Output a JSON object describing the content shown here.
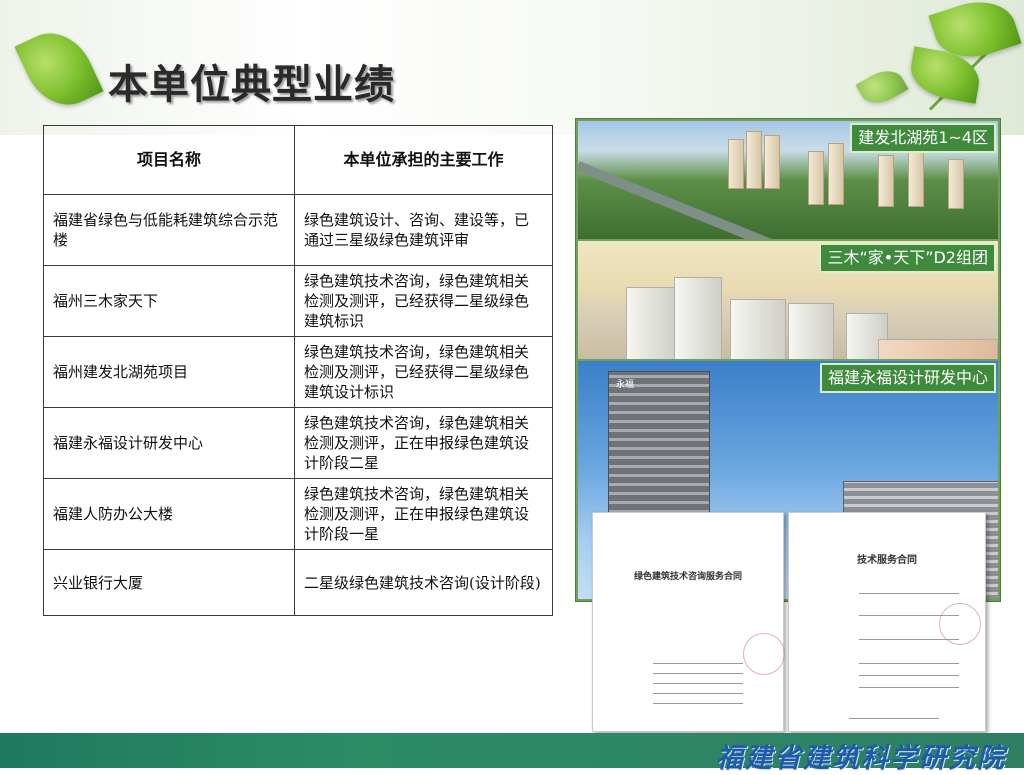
{
  "page_title": "本单位典型业绩",
  "table": {
    "headers": [
      "项目名称",
      "本单位承担的主要工作"
    ],
    "rows": [
      {
        "name": "福建省绿色与低能耗建筑综合示范楼",
        "work": "绿色建筑设计、咨询、建设等，已通过三星级绿色建筑评审"
      },
      {
        "name": "福州三木家天下",
        "work": "绿色建筑技术咨询，绿色建筑相关检测及测评，已经获得二星级绿色建筑标识"
      },
      {
        "name": "福州建发北湖苑项目",
        "work": "绿色建筑技术咨询，绿色建筑相关检测及测评，已经获得二星级绿色建筑设计标识"
      },
      {
        "name": "福建永福设计研发中心",
        "work": "绿色建筑技术咨询，绿色建筑相关检测及测评，正在申报绿色建筑设计阶段二星"
      },
      {
        "name": "福建人防办公大楼",
        "work": "绿色建筑技术咨询，绿色建筑相关检测及测评，正在申报绿色建筑设计阶段一星"
      },
      {
        "name": "兴业银行大厦",
        "work": "二星级绿色建筑技术咨询(设计阶段)"
      }
    ]
  },
  "photos": {
    "captions": [
      "建发北湖苑1~4区",
      "三木“家•天下”D2组团",
      "福建永福设计研发中心"
    ],
    "tower_sign": "永福"
  },
  "documents": [
    {
      "title": "绿色建筑技术咨询服务合同"
    },
    {
      "title": "技术服务合同"
    }
  ],
  "footer": {
    "institute": "福建省建筑科学研究院"
  }
}
